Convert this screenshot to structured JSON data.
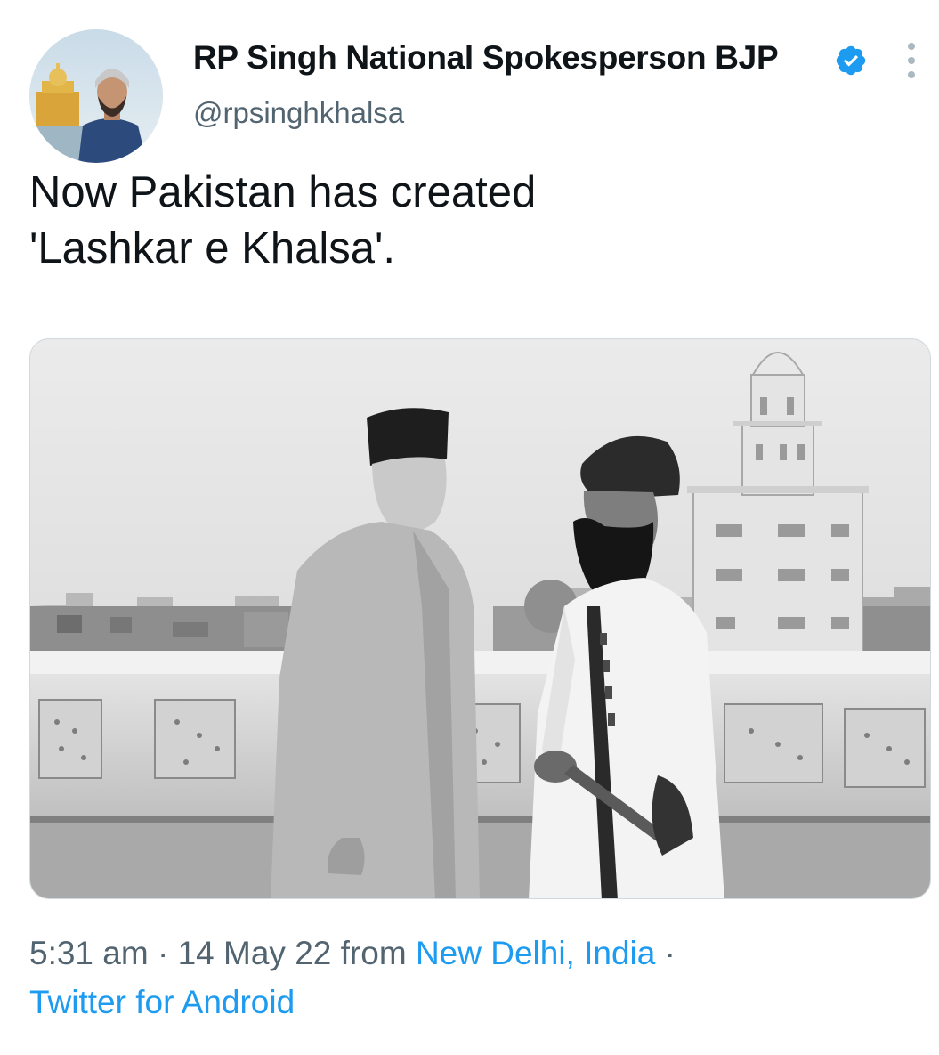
{
  "tweet": {
    "author": {
      "display_name": "RP Singh National Spokesperson BJP",
      "handle": "@rpsinghkhalsa",
      "verified": true,
      "avatar_icon": "profile-avatar"
    },
    "text_lines": [
      "Now Pakistan has created",
      "'Lashkar e Khalsa'."
    ],
    "media": {
      "type": "photo",
      "style": "black-and-white"
    },
    "meta": {
      "time": "5:31 am",
      "separator": "·",
      "date": "14 May 22",
      "from_label": "from",
      "location": "New Delhi, India",
      "trailing_separator": "·",
      "source": "Twitter for Android"
    },
    "more_icon": "more-vertical-icon"
  },
  "colors": {
    "text_primary": "#0f1419",
    "text_secondary": "#536471",
    "link": "#1d9bf0",
    "verified": "#1d9bf0"
  }
}
